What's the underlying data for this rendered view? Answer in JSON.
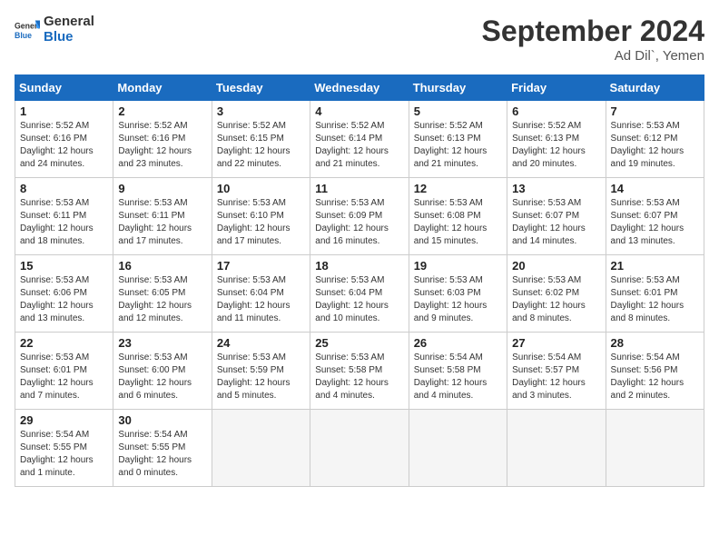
{
  "logo": {
    "line1": "General",
    "line2": "Blue"
  },
  "title": "September 2024",
  "location": "Ad Dil`, Yemen",
  "days_of_week": [
    "Sunday",
    "Monday",
    "Tuesday",
    "Wednesday",
    "Thursday",
    "Friday",
    "Saturday"
  ],
  "weeks": [
    [
      {
        "day": 1,
        "sunrise": "5:52 AM",
        "sunset": "6:16 PM",
        "daylight": "12 hours and 24 minutes."
      },
      {
        "day": 2,
        "sunrise": "5:52 AM",
        "sunset": "6:16 PM",
        "daylight": "12 hours and 23 minutes."
      },
      {
        "day": 3,
        "sunrise": "5:52 AM",
        "sunset": "6:15 PM",
        "daylight": "12 hours and 22 minutes."
      },
      {
        "day": 4,
        "sunrise": "5:52 AM",
        "sunset": "6:14 PM",
        "daylight": "12 hours and 21 minutes."
      },
      {
        "day": 5,
        "sunrise": "5:52 AM",
        "sunset": "6:13 PM",
        "daylight": "12 hours and 21 minutes."
      },
      {
        "day": 6,
        "sunrise": "5:52 AM",
        "sunset": "6:13 PM",
        "daylight": "12 hours and 20 minutes."
      },
      {
        "day": 7,
        "sunrise": "5:53 AM",
        "sunset": "6:12 PM",
        "daylight": "12 hours and 19 minutes."
      }
    ],
    [
      {
        "day": 8,
        "sunrise": "5:53 AM",
        "sunset": "6:11 PM",
        "daylight": "12 hours and 18 minutes."
      },
      {
        "day": 9,
        "sunrise": "5:53 AM",
        "sunset": "6:11 PM",
        "daylight": "12 hours and 17 minutes."
      },
      {
        "day": 10,
        "sunrise": "5:53 AM",
        "sunset": "6:10 PM",
        "daylight": "12 hours and 17 minutes."
      },
      {
        "day": 11,
        "sunrise": "5:53 AM",
        "sunset": "6:09 PM",
        "daylight": "12 hours and 16 minutes."
      },
      {
        "day": 12,
        "sunrise": "5:53 AM",
        "sunset": "6:08 PM",
        "daylight": "12 hours and 15 minutes."
      },
      {
        "day": 13,
        "sunrise": "5:53 AM",
        "sunset": "6:07 PM",
        "daylight": "12 hours and 14 minutes."
      },
      {
        "day": 14,
        "sunrise": "5:53 AM",
        "sunset": "6:07 PM",
        "daylight": "12 hours and 13 minutes."
      }
    ],
    [
      {
        "day": 15,
        "sunrise": "5:53 AM",
        "sunset": "6:06 PM",
        "daylight": "12 hours and 13 minutes."
      },
      {
        "day": 16,
        "sunrise": "5:53 AM",
        "sunset": "6:05 PM",
        "daylight": "12 hours and 12 minutes."
      },
      {
        "day": 17,
        "sunrise": "5:53 AM",
        "sunset": "6:04 PM",
        "daylight": "12 hours and 11 minutes."
      },
      {
        "day": 18,
        "sunrise": "5:53 AM",
        "sunset": "6:04 PM",
        "daylight": "12 hours and 10 minutes."
      },
      {
        "day": 19,
        "sunrise": "5:53 AM",
        "sunset": "6:03 PM",
        "daylight": "12 hours and 9 minutes."
      },
      {
        "day": 20,
        "sunrise": "5:53 AM",
        "sunset": "6:02 PM",
        "daylight": "12 hours and 8 minutes."
      },
      {
        "day": 21,
        "sunrise": "5:53 AM",
        "sunset": "6:01 PM",
        "daylight": "12 hours and 8 minutes."
      }
    ],
    [
      {
        "day": 22,
        "sunrise": "5:53 AM",
        "sunset": "6:01 PM",
        "daylight": "12 hours and 7 minutes."
      },
      {
        "day": 23,
        "sunrise": "5:53 AM",
        "sunset": "6:00 PM",
        "daylight": "12 hours and 6 minutes."
      },
      {
        "day": 24,
        "sunrise": "5:53 AM",
        "sunset": "5:59 PM",
        "daylight": "12 hours and 5 minutes."
      },
      {
        "day": 25,
        "sunrise": "5:53 AM",
        "sunset": "5:58 PM",
        "daylight": "12 hours and 4 minutes."
      },
      {
        "day": 26,
        "sunrise": "5:54 AM",
        "sunset": "5:58 PM",
        "daylight": "12 hours and 4 minutes."
      },
      {
        "day": 27,
        "sunrise": "5:54 AM",
        "sunset": "5:57 PM",
        "daylight": "12 hours and 3 minutes."
      },
      {
        "day": 28,
        "sunrise": "5:54 AM",
        "sunset": "5:56 PM",
        "daylight": "12 hours and 2 minutes."
      }
    ],
    [
      {
        "day": 29,
        "sunrise": "5:54 AM",
        "sunset": "5:55 PM",
        "daylight": "12 hours and 1 minute."
      },
      {
        "day": 30,
        "sunrise": "5:54 AM",
        "sunset": "5:55 PM",
        "daylight": "12 hours and 0 minutes."
      },
      null,
      null,
      null,
      null,
      null
    ]
  ]
}
